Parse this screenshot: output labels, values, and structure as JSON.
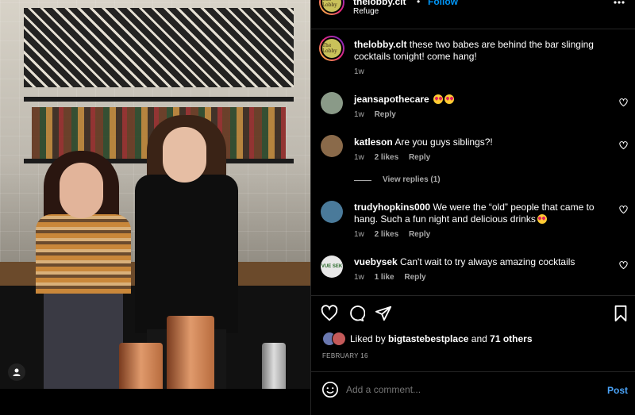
{
  "post": {
    "account": "thelobby.clt",
    "dot": "•",
    "follow_label": "Follow",
    "location": "Refuge",
    "avatar_text": "The Lobby",
    "caption": "these two babes are behind the bar slinging cocktails tonight! come hang!",
    "caption_time": "1w"
  },
  "comments": [
    {
      "user": "jeansapothecare",
      "text": "",
      "emoji_count": 2,
      "time": "1w",
      "likes": "",
      "reply": "Reply",
      "avatar_color": "#8a9a88"
    },
    {
      "user": "katleson",
      "text": "Are you guys siblings?!",
      "emoji_count": 0,
      "time": "1w",
      "likes": "2 likes",
      "reply": "Reply",
      "avatar_color": "#8a6a4a",
      "view_replies": "View replies (1)"
    },
    {
      "user": "trudyhopkins000",
      "text": "We were the “old” people that came to hang. Such a fun night and delicious drinks",
      "emoji_count": 1,
      "time": "1w",
      "likes": "2 likes",
      "reply": "Reply",
      "avatar_color": "#4a7a9a"
    },
    {
      "user": "vuebysek",
      "text": "Can't wait to try always amazing cocktails",
      "emoji_count": 0,
      "time": "1w",
      "likes": "1 like",
      "reply": "Reply",
      "avatar_color": "#e8e8e8",
      "avatar_text": "VUE SEK"
    }
  ],
  "actions": {
    "liked_by_prefix": "Liked by",
    "liked_by_user": "bigtastebestplace",
    "liked_by_and": "and",
    "liked_by_others": "71 others",
    "date": "FEBRUARY 16"
  },
  "composer": {
    "placeholder": "Add a comment...",
    "post_label": "Post"
  },
  "icons": {
    "more": "more-icon",
    "heart": "heart-icon",
    "comment": "comment-icon",
    "share": "share-icon",
    "save": "bookmark-icon",
    "emoji": "emoji-icon",
    "user_tag": "user-tag-icon"
  },
  "colors": {
    "link": "#0095f6",
    "muted": "#a8a8a8",
    "background": "#000000"
  }
}
